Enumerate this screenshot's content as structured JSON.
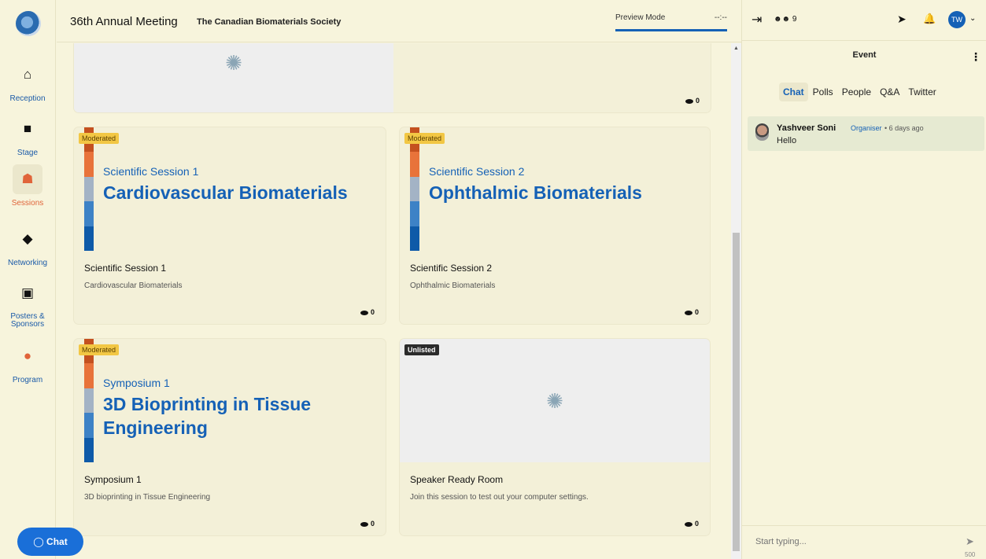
{
  "nav": {
    "items": [
      {
        "label": "Reception",
        "icon": "home-icon",
        "glyph": "⌂"
      },
      {
        "label": "Stage",
        "icon": "video-icon",
        "glyph": "■"
      },
      {
        "label": "Sessions",
        "icon": "sessions-icon",
        "glyph": "☗"
      },
      {
        "label": "Networking",
        "icon": "handshake-icon",
        "glyph": "◆"
      },
      {
        "label": "Posters & Sponsors",
        "icon": "booth-icon",
        "glyph": "▣"
      },
      {
        "label": "Program",
        "icon": "program-icon",
        "glyph": "●"
      }
    ]
  },
  "header": {
    "event_title": "36th Annual Meeting",
    "org_name": "The Canadian Biomaterials Society",
    "preview_label": "Preview Mode",
    "preview_time": "--:--"
  },
  "cards": [
    {
      "title": "Scientific Session 1",
      "desc": "Cardiovascular Biomaterials",
      "badge": "Moderated",
      "thumb_sub": "Scientific Session 1",
      "thumb_big": "Cardiovascular Biomaterials",
      "views": "0"
    },
    {
      "title": "Scientific Session 2",
      "desc": "Ophthalmic Biomaterials",
      "badge": "Moderated",
      "thumb_sub": "Scientific Session 2",
      "thumb_big": "Ophthalmic Biomaterials",
      "views": "0"
    },
    {
      "title": "Symposium 1",
      "desc": "3D bioprinting in Tissue Engineering",
      "badge": "Moderated",
      "thumb_sub": "Symposium 1",
      "thumb_big": "3D Bioprinting in Tissue Engineering",
      "views": "0"
    },
    {
      "title": "Speaker Ready Room",
      "desc": "Join this session to test out your computer settings.",
      "badge": "Unlisted",
      "views": "0"
    }
  ],
  "top_card": {
    "views": "0"
  },
  "colors": {
    "accent": "#1561b6",
    "stripe": [
      "#c4511f",
      "#e8733a",
      "#a3b3c5",
      "#3d82c6",
      "#0e5aa8"
    ]
  },
  "rpanel": {
    "people_count": "9",
    "avatar_initials": "TW",
    "heading": "Event",
    "tabs": [
      "Chat",
      "Polls",
      "People",
      "Q&A",
      "Twitter"
    ],
    "message": {
      "name": "Yashveer Soni",
      "role": "Organiser",
      "time": "• 6 days ago",
      "text": "Hello"
    },
    "composer_placeholder": "Start typing...",
    "char_count": "500"
  },
  "chat_pill": "Chat"
}
